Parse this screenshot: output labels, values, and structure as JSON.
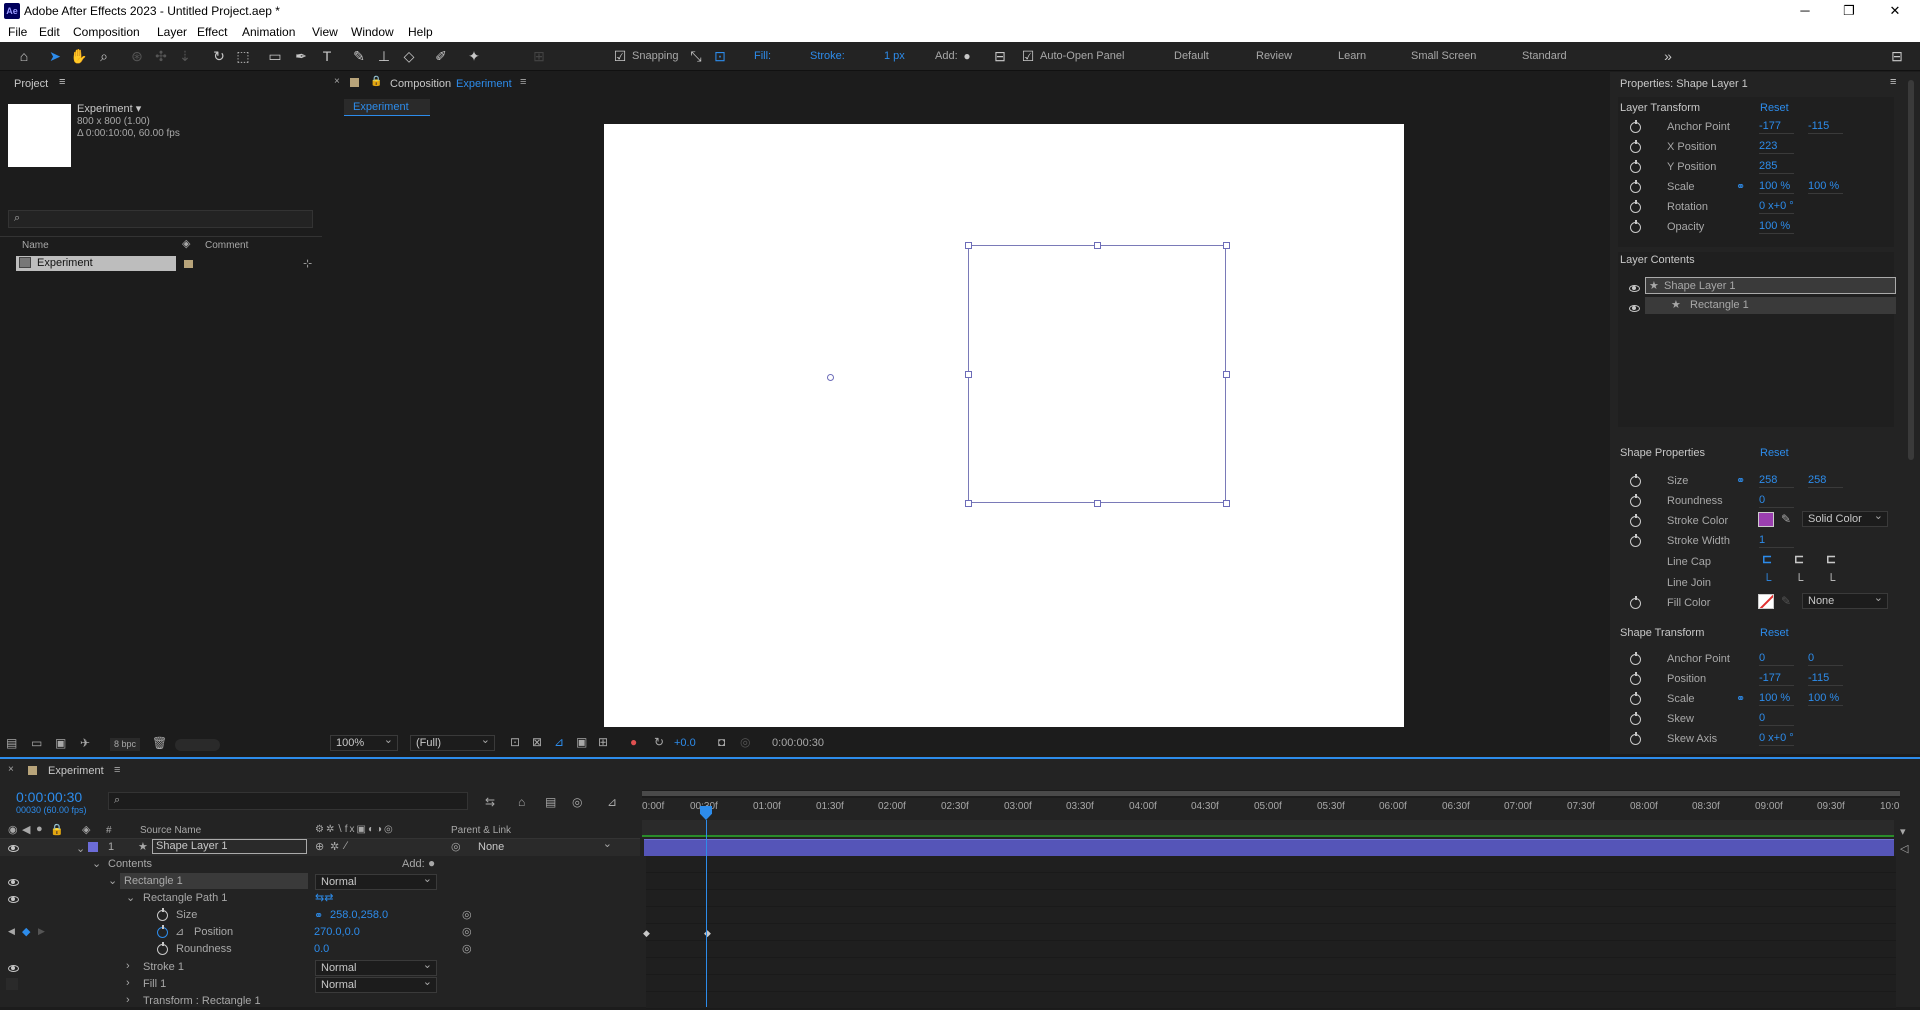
{
  "app": {
    "title": "Adobe After Effects 2023 - Untitled Project.aep *",
    "logo": "Ae"
  },
  "window": {
    "minimize": "─",
    "maximize": "❐",
    "close": "✕"
  },
  "menu": [
    "File",
    "Edit",
    "Composition",
    "Layer",
    "Effect",
    "Animation",
    "View",
    "Window",
    "Help"
  ],
  "toolbar": {
    "snapping": "Snapping",
    "fill": "Fill:",
    "stroke": "Stroke:",
    "stroke_width": "1 px",
    "add": "Add:",
    "auto_open": "Auto-Open Panel",
    "workspaces": [
      "Default",
      "Review",
      "Learn",
      "Small Screen",
      "Standard"
    ],
    "more": "»",
    "fill_color": "#d84040",
    "stroke_color": "#9b3fb0"
  },
  "project": {
    "title": "Project",
    "comp_name": "Experiment ▾",
    "comp_size": "800 x 800 (1.00)",
    "comp_duration": "Δ 0:00:10:00, 60.00 fps",
    "col_name": "Name",
    "col_comment": "Comment",
    "item": "Experiment",
    "bpc": "8 bpc"
  },
  "composition": {
    "title": "Composition",
    "name": "Experiment",
    "tab": "Experiment",
    "zoom": "100%",
    "resolution": "(Full)",
    "exposure": "+0.0",
    "timecode": "0:00:00:30"
  },
  "properties": {
    "title": "Properties: Shape Layer 1",
    "layer_transform": {
      "title": "Layer Transform",
      "reset": "Reset",
      "rows": [
        {
          "label": "Anchor Point",
          "v1": "-177",
          "v2": "-115"
        },
        {
          "label": "X Position",
          "v1": "223"
        },
        {
          "label": "Y Position",
          "v1": "285"
        },
        {
          "label": "Scale",
          "v1": "100 %",
          "v2": "100 %"
        },
        {
          "label": "Rotation",
          "v1": "0 x+0 °"
        },
        {
          "label": "Opacity",
          "v1": "100 %"
        }
      ]
    },
    "layer_contents": {
      "title": "Layer Contents",
      "items": [
        "Shape Layer 1",
        "Rectangle 1"
      ]
    },
    "shape_properties": {
      "title": "Shape Properties",
      "reset": "Reset",
      "size": [
        "258",
        "258"
      ],
      "roundness": "0",
      "stroke_color": "#9b3fb0",
      "stroke_type": "Solid Color",
      "stroke_width": "1",
      "fill_type": "None",
      "labels": [
        "Size",
        "Roundness",
        "Stroke Color",
        "Stroke Width",
        "Line Cap",
        "Line Join",
        "Fill Color"
      ]
    },
    "shape_transform": {
      "title": "Shape Transform",
      "reset": "Reset",
      "rows": [
        {
          "label": "Anchor Point",
          "v1": "0",
          "v2": "0"
        },
        {
          "label": "Position",
          "v1": "-177",
          "v2": "-115"
        },
        {
          "label": "Scale",
          "v1": "100 %",
          "v2": "100 %"
        },
        {
          "label": "Skew",
          "v1": "0"
        },
        {
          "label": "Skew Axis",
          "v1": "0 x+0 °"
        }
      ]
    }
  },
  "timeline": {
    "comp": "Experiment",
    "time": "0:00:00:30",
    "frames": "00030 (60.00 fps)",
    "col_source": "Source Name",
    "col_parent": "Parent & Link",
    "layer_num": "1",
    "layer_name": "Shape Layer 1",
    "parent": "None",
    "contents": "Contents",
    "add": "Add:",
    "rect": "Rectangle 1",
    "rect_mode": "Normal",
    "path": "Rectangle Path 1",
    "size_label": "Size",
    "size_val": "258.0,258.0",
    "pos_label": "Position",
    "pos_val": "270.0,0.0",
    "round_label": "Roundness",
    "round_val": "0.0",
    "stroke": "Stroke 1",
    "stroke_mode": "Normal",
    "fill": "Fill 1",
    "fill_mode": "Normal",
    "transform": "Transform : Rectangle 1",
    "ticks": [
      "0:00f",
      "00:30f",
      "01:00f",
      "01:30f",
      "02:00f",
      "02:30f",
      "03:00f",
      "03:30f",
      "04:00f",
      "04:30f",
      "05:00f",
      "05:30f",
      "06:00f",
      "06:30f",
      "07:00f",
      "07:30f",
      "08:00f",
      "08:30f",
      "09:00f",
      "09:30f",
      "10:0"
    ]
  }
}
